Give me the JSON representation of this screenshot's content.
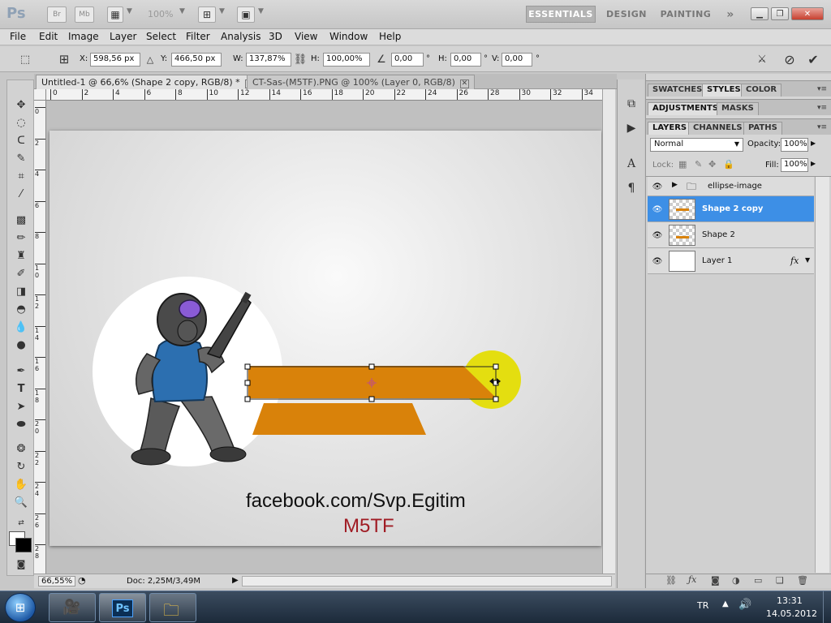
{
  "titlebar": {
    "app_logo": "Ps",
    "br_label": "Br",
    "mb_label": "Mb",
    "zoom_display": "100%",
    "workspaces": [
      "ESSENTIALS",
      "DESIGN",
      "PAINTING"
    ],
    "more_label": "»"
  },
  "menu": [
    "File",
    "Edit",
    "Image",
    "Layer",
    "Select",
    "Filter",
    "Analysis",
    "3D",
    "View",
    "Window",
    "Help"
  ],
  "options": {
    "x_label": "X:",
    "x_value": "598,56 px",
    "y_label": "Y:",
    "y_value": "466,50 px",
    "w_label": "W:",
    "w_value": "137,87%",
    "h_label": "H:",
    "h_value": "100,00%",
    "angle_value": "0,00",
    "hskew_label": "H:",
    "hskew_value": "0,00",
    "vskew_label": "V:",
    "vskew_value": "0,00",
    "degree_symbol": "°"
  },
  "doc_tabs": [
    {
      "label": "Untitled-1 @ 66,6% (Shape 2 copy, RGB/8) *",
      "active": true
    },
    {
      "label": "CT-Sas-(M5TF).PNG @ 100% (Layer 0, RGB/8)",
      "active": false
    }
  ],
  "ruler_top_labels": [
    "0",
    "2",
    "4",
    "6",
    "8",
    "10",
    "12",
    "14",
    "16",
    "18",
    "20",
    "22",
    "24",
    "26",
    "28",
    "30",
    "32",
    "34"
  ],
  "ruler_left_labels": [
    "0",
    "2",
    "4",
    "6",
    "8",
    "1\n0",
    "1\n2",
    "1\n4",
    "1\n6",
    "1\n8",
    "2\n0",
    "2\n2",
    "2\n4",
    "2\n6",
    "2\n8"
  ],
  "canvas": {
    "facebook_text": "facebook.com/Svp.Egitim",
    "brand_text": "M5TF",
    "shape_color": "#d9820a",
    "circle_color": "#e6e00f",
    "brand_color": "#a01c24"
  },
  "status": {
    "zoom": "66,55%",
    "doc_info": "Doc: 2,25M/3,49M"
  },
  "panels": {
    "group1_tabs": [
      "SWATCHES",
      "STYLES",
      "COLOR"
    ],
    "group2_tabs": [
      "ADJUSTMENTS",
      "MASKS"
    ],
    "group3_tabs": [
      "LAYERS",
      "CHANNELS",
      "PATHS"
    ],
    "blend_mode": "Normal",
    "opacity_label": "Opacity:",
    "opacity_value": "100%",
    "lock_label": "Lock:",
    "fill_label": "Fill:",
    "fill_value": "100%",
    "layers": [
      {
        "name": "ellipse-image",
        "type": "group",
        "selected": false
      },
      {
        "name": "Shape 2 copy",
        "type": "shape",
        "selected": true
      },
      {
        "name": "Shape 2",
        "type": "shape",
        "selected": false
      },
      {
        "name": "Layer 1",
        "type": "fill",
        "selected": false,
        "fx": "fx"
      }
    ]
  },
  "taskbar": {
    "language": "TR",
    "time": "13:31",
    "date": "14.05.2012",
    "ps_label": "Ps"
  }
}
